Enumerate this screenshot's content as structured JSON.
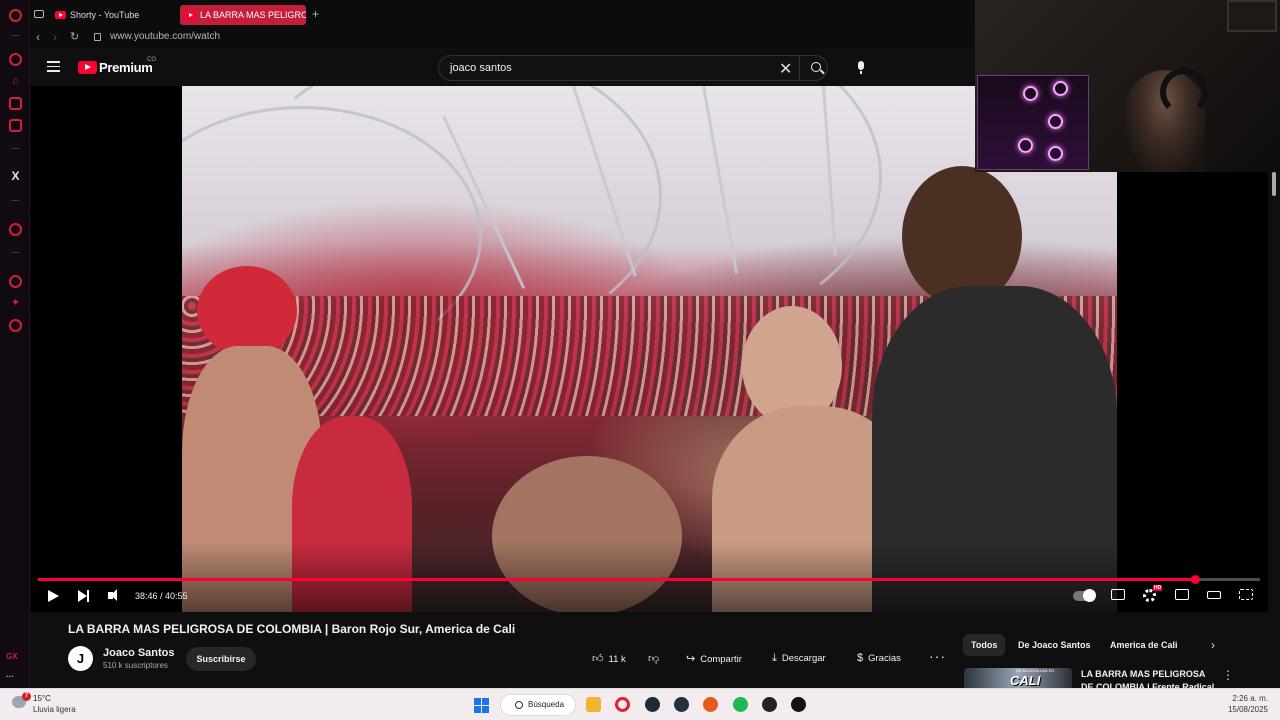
{
  "browser": {
    "tabs": [
      {
        "label": "Shorty - YouTube",
        "active": false
      },
      {
        "label": "LA BARRA MAS PELIGROSA DE COLOMBIA",
        "active": true
      }
    ],
    "url": "www.youtube.com/watch",
    "sidebar_bottom_label": "GX",
    "sidebar_more": "···"
  },
  "youtube": {
    "logo_text": "Premium",
    "region": "CO",
    "search_value": "joaco santos"
  },
  "player": {
    "time_current": "38:46",
    "time_total": "40:55",
    "time_display": "38:46 / 40:55",
    "progress_fraction": 0.947,
    "quality_badge": "HD",
    "accent_color": "#ff0033"
  },
  "video": {
    "title": "LA BARRA MAS PELIGROSA DE COLOMBIA | Baron Rojo Sur, America de Cali",
    "channel_initial": "J",
    "channel_name": "Joaco Santos",
    "subscribers": "510 k suscriptores",
    "subscribe_label": "Suscribirse",
    "likes": "11 k",
    "share_label": "Compartir",
    "download_label": "Descargar",
    "thanks_label": "Gracias",
    "more_label": "···"
  },
  "related": {
    "chips": [
      "Todos",
      "De Joaco Santos",
      "America de Cali"
    ],
    "first_item_title": "LA BARRA MAS PELIGROSA DE COLOMBIA | Frente Radical",
    "first_item_thumb_text": "CALI",
    "first_item_thumb_small": "SE ACUCHILLAN EN"
  },
  "taskbar": {
    "temperature": "15°C",
    "condition": "Lluvia ligera",
    "weather_badge": "7",
    "search_label": "Búsqueda",
    "time": "2:26 a. m.",
    "date": "15/08/2025"
  }
}
